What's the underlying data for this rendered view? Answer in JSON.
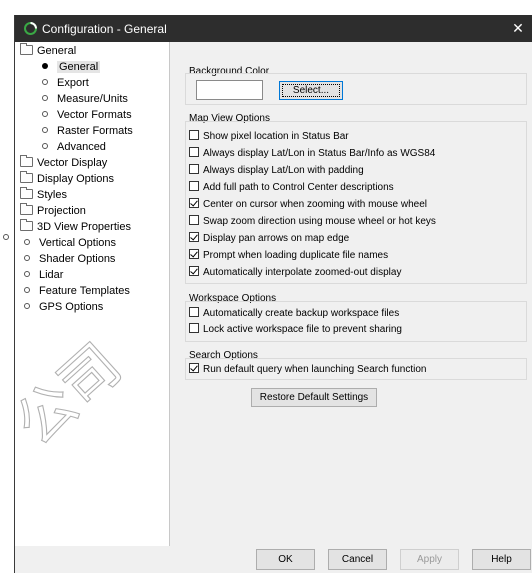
{
  "window": {
    "title": "Configuration - General",
    "close_glyph": "✕"
  },
  "tree": {
    "items": [
      {
        "label": "General",
        "kind": "folder"
      },
      {
        "label": "General",
        "kind": "filled"
      },
      {
        "label": "Export",
        "kind": "bullet"
      },
      {
        "label": "Measure/Units",
        "kind": "bullet"
      },
      {
        "label": "Vector Formats",
        "kind": "bullet"
      },
      {
        "label": "Raster Formats",
        "kind": "bullet"
      },
      {
        "label": "Advanced",
        "kind": "bullet"
      },
      {
        "label": "Vector Display",
        "kind": "folder"
      },
      {
        "label": "Display Options",
        "kind": "folder"
      },
      {
        "label": "Styles",
        "kind": "folder"
      },
      {
        "label": "Projection",
        "kind": "folder"
      },
      {
        "label": "3D View Properties",
        "kind": "folder"
      },
      {
        "label": "Vertical Options",
        "kind": "bullet"
      },
      {
        "label": "Shader Options",
        "kind": "bullet"
      },
      {
        "label": "Lidar",
        "kind": "bullet"
      },
      {
        "label": "Feature Templates",
        "kind": "bullet"
      },
      {
        "label": "GPS Options",
        "kind": "bullet"
      }
    ]
  },
  "background_color": {
    "title": "Background Color",
    "select_label": "Select..."
  },
  "map_view": {
    "title": "Map View Options",
    "options": [
      {
        "label": "Show pixel location in Status Bar",
        "checked": false
      },
      {
        "label": "Always display Lat/Lon in Status Bar/Info as WGS84",
        "checked": false
      },
      {
        "label": "Always display Lat/Lon with padding",
        "checked": false
      },
      {
        "label": "Add full path to Control Center descriptions",
        "checked": false
      },
      {
        "label": "Center on cursor when zooming with mouse wheel",
        "checked": true
      },
      {
        "label": "Swap zoom direction using mouse wheel or hot keys",
        "checked": false
      },
      {
        "label": "Display pan arrows on map edge",
        "checked": true
      },
      {
        "label": "Prompt when loading duplicate file names",
        "checked": true
      },
      {
        "label": "Automatically interpolate zoomed-out display",
        "checked": true
      }
    ]
  },
  "workspace": {
    "title": "Workspace Options",
    "options": [
      {
        "label": "Automatically create backup workspace files",
        "checked": false
      },
      {
        "label": "Lock active workspace file to prevent sharing",
        "checked": false
      }
    ]
  },
  "search": {
    "title": "Search Options",
    "options": [
      {
        "label": "Run default query when launching Search function",
        "checked": true
      }
    ]
  },
  "restore_label": "Restore Default Settings",
  "buttons": {
    "ok": "OK",
    "cancel": "Cancel",
    "apply": "Apply",
    "help": "Help"
  },
  "watermark_text": "公司",
  "colors": {
    "titlebar": "#2d2d2d",
    "dialog_bg": "#f0f0f0",
    "focus": "#0078d7",
    "app_icon": "#3aa845"
  }
}
